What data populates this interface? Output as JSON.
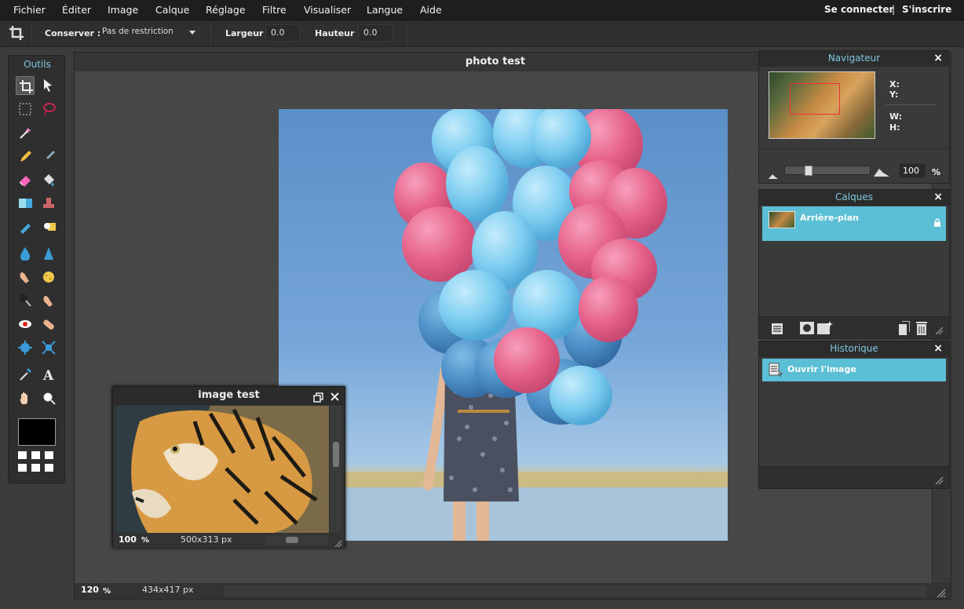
{
  "menu": {
    "items": [
      "Fichier",
      "Éditer",
      "Image",
      "Calque",
      "Réglage",
      "Filtre",
      "Visualiser",
      "Langue",
      "Aide"
    ],
    "login": "Se connecter",
    "separator": "|",
    "signup": "S'inscrire"
  },
  "options": {
    "keep_label": "Conserver :",
    "keep_value": "Pas de restriction",
    "width_label": "Largeur :",
    "width_value": "0.0",
    "height_label": "Hauteur :",
    "height_value": "0.0"
  },
  "tools": {
    "title": "Outils",
    "icons": [
      "crop-icon",
      "move-icon",
      "marquee-icon",
      "lasso-icon",
      "magic-wand-icon",
      "pencil-icon",
      "brush-icon",
      "eraser-icon",
      "paint-bucket-icon",
      "gradient-icon",
      "clone-stamp-icon",
      "color-replace-icon",
      "drawing-icon",
      "blur-icon",
      "sharpen-icon",
      "smudge-icon",
      "sponge-icon",
      "dodge-icon",
      "burn-icon",
      "red-eye-icon",
      "spot-heal-icon",
      "bloat-icon",
      "pinch-icon",
      "color-picker-icon",
      "type-icon",
      "hand-icon",
      "zoom-icon"
    ],
    "foreground_color": "#000000"
  },
  "document": {
    "title": "photo test",
    "zoom": "120",
    "zoom_unit": "%",
    "size": "434x417 px"
  },
  "image_window": {
    "title": "image test",
    "zoom": "100",
    "zoom_unit": "%",
    "size": "500x313 px"
  },
  "navigator": {
    "title": "Navigateur",
    "x_label": "X:",
    "y_label": "Y:",
    "w_label": "W:",
    "h_label": "H:",
    "zoom_value": "100",
    "zoom_unit": "%",
    "zoom_fraction": 0.25
  },
  "layers": {
    "title": "Calques",
    "items": [
      {
        "name": "Arrière-plan",
        "locked": true
      }
    ]
  },
  "history": {
    "title": "Historique",
    "items": [
      "Ouvrir l'image"
    ]
  },
  "colors": {
    "accent": "#5bbfd6",
    "panel_title": "#7ec8e3",
    "menubar": "#1e1e1e",
    "panel": "#3a3a3a"
  }
}
